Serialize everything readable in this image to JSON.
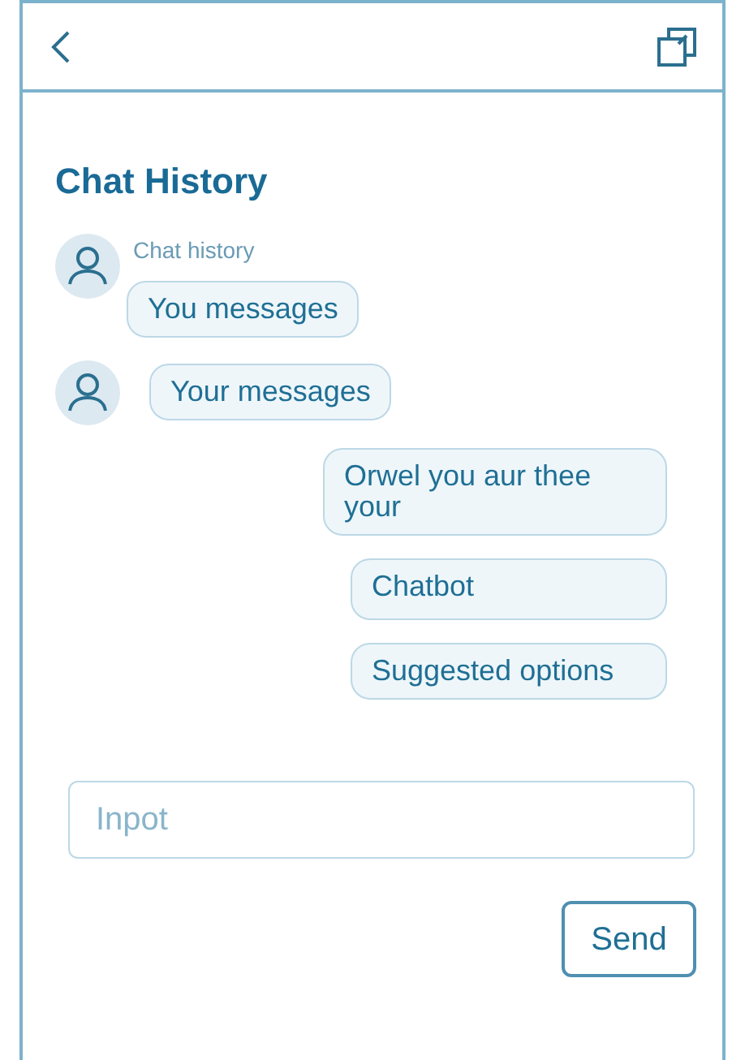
{
  "title": "Chat History",
  "messages": [
    {
      "kind": "received",
      "sender": "Chat history",
      "text": "You messages"
    },
    {
      "kind": "received",
      "text": "Your messages"
    },
    {
      "kind": "sent",
      "text": "Orwel you aur thee your"
    },
    {
      "kind": "sent",
      "text": "Chatbot"
    },
    {
      "kind": "sent",
      "text": "Suggested options"
    }
  ],
  "input": {
    "placeholder": "Inpot"
  },
  "send": "Send"
}
